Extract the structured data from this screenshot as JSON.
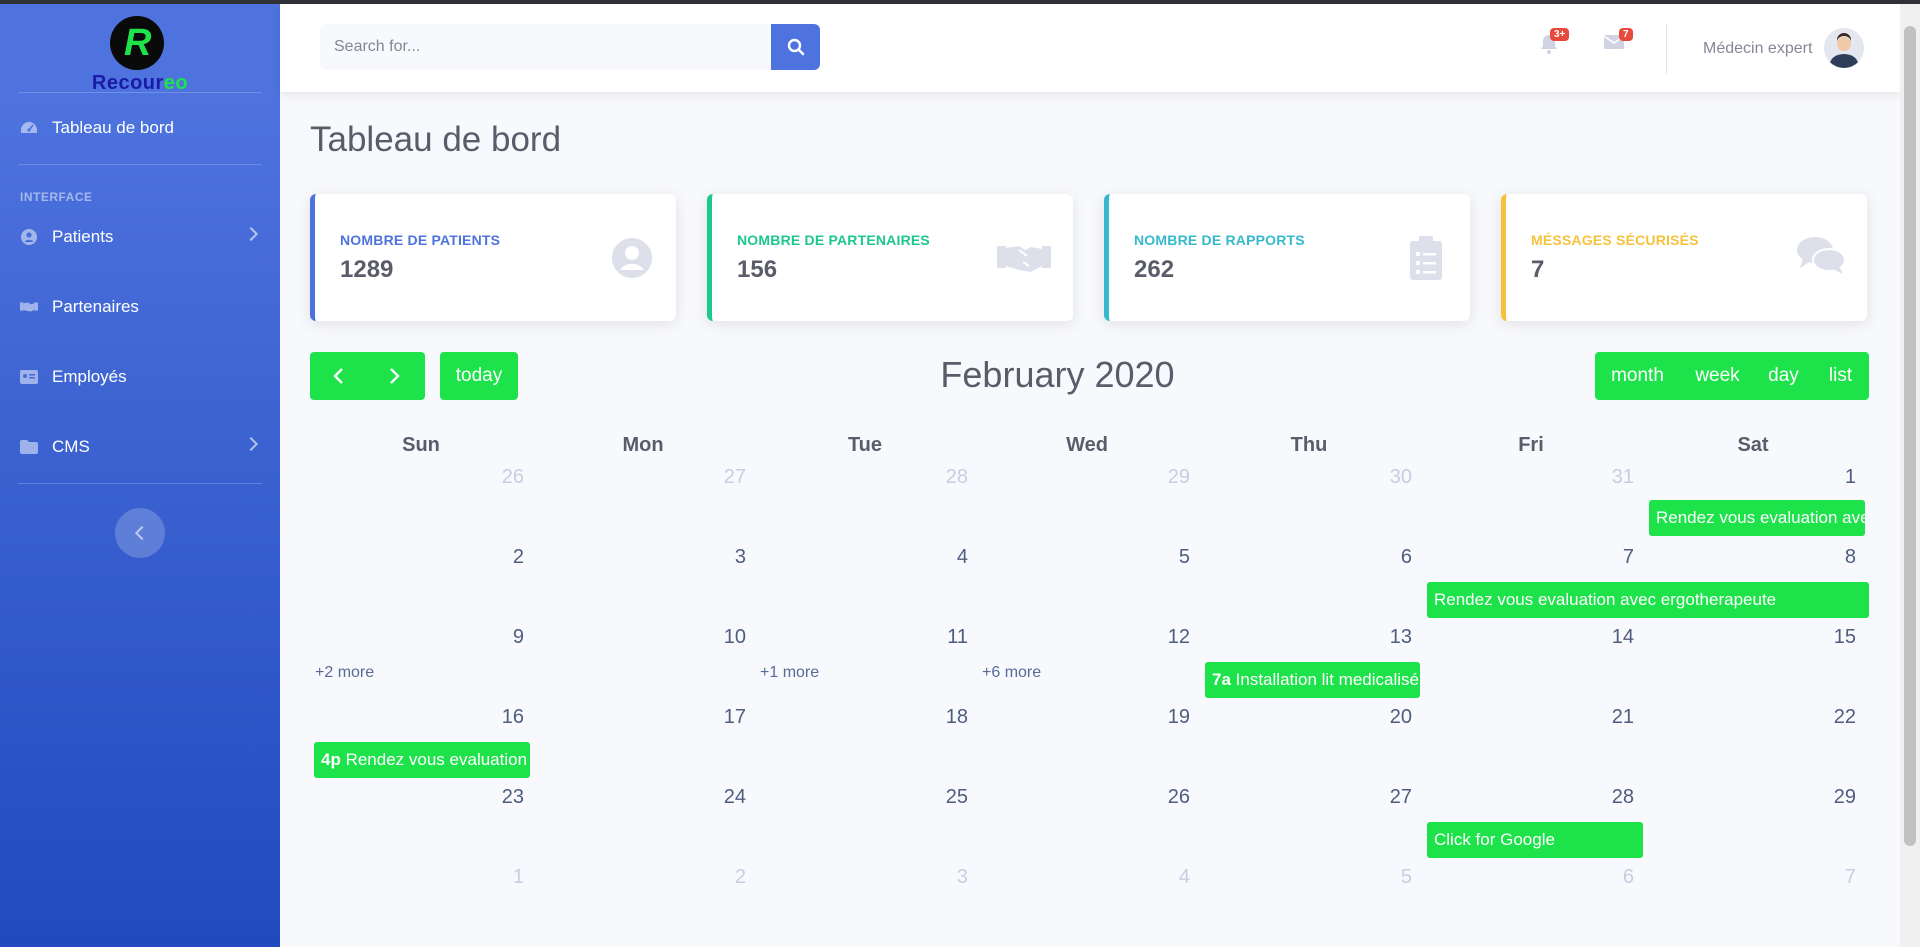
{
  "brand": {
    "name_main": "Recour",
    "name_accent": "eo",
    "logo_letter": "R"
  },
  "sidebar": {
    "dashboard": "Tableau de bord",
    "heading": "INTERFACE",
    "items": [
      {
        "label": "Patients",
        "icon": "user-circle-icon"
      },
      {
        "label": "Partenaires",
        "icon": "handshake-icon"
      },
      {
        "label": "Employés",
        "icon": "id-card-icon"
      },
      {
        "label": "CMS",
        "icon": "folder-icon"
      }
    ]
  },
  "topbar": {
    "search_placeholder": "Search for...",
    "alerts_badge": "3+",
    "messages_badge": "7",
    "user_name": "Médecin expert"
  },
  "page": {
    "title": "Tableau de bord"
  },
  "cards": [
    {
      "label": "NOMBRE DE PATIENTS",
      "value": "1289",
      "color": "#4e73df",
      "icon": "user-circle-icon"
    },
    {
      "label": "NOMBRE DE PARTENAIRES",
      "value": "156",
      "color": "#1cc88a",
      "icon": "handshake-icon"
    },
    {
      "label": "NOMBRE DE RAPPORTS",
      "value": "262",
      "color": "#36b9cc",
      "icon": "clipboard-list-icon"
    },
    {
      "label": "MÉSSAGES SÉCURISÉS",
      "value": "7",
      "color": "#f6c23e",
      "icon": "comments-icon"
    }
  ],
  "calendar": {
    "title": "February 2020",
    "today_label": "today",
    "views": [
      "month",
      "week",
      "day",
      "list"
    ],
    "weekdays": [
      "Sun",
      "Mon",
      "Tue",
      "Wed",
      "Thu",
      "Fri",
      "Sat"
    ],
    "weeks": [
      [
        "26",
        "27",
        "28",
        "29",
        "30",
        "31",
        "1"
      ],
      [
        "2",
        "3",
        "4",
        "5",
        "6",
        "7",
        "8"
      ],
      [
        "9",
        "10",
        "11",
        "12",
        "13",
        "14",
        "15"
      ],
      [
        "16",
        "17",
        "18",
        "19",
        "20",
        "21",
        "22"
      ],
      [
        "23",
        "24",
        "25",
        "26",
        "27",
        "28",
        "29"
      ],
      [
        "1",
        "2",
        "3",
        "4",
        "5",
        "6",
        "7"
      ]
    ],
    "more_links": [
      "+2 more",
      "+1 more",
      "+6 more"
    ],
    "events": [
      {
        "time": "",
        "title": "Rendez vous evaluation avec ergotherapeute"
      },
      {
        "time": "",
        "title": "Rendez vous evaluation avec ergotherapeute"
      },
      {
        "time": "7a",
        "title": "Installation lit medicalisé"
      },
      {
        "time": "4p",
        "title": "Rendez vous evaluation"
      },
      {
        "time": "",
        "title": "Click for Google"
      }
    ],
    "accent": "#1de24a"
  }
}
